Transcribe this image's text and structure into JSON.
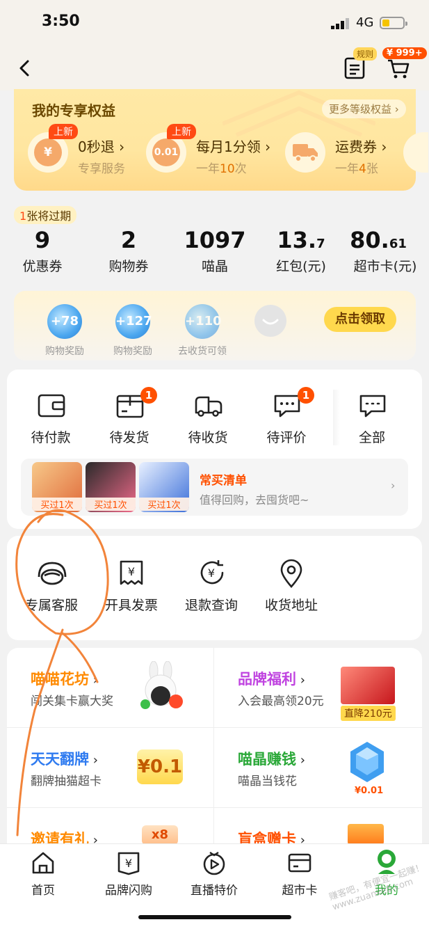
{
  "status_bar": {
    "time": "3:50",
    "network": "4G"
  },
  "header": {
    "rule_badge": "规则",
    "cart_badge": "¥ 999+"
  },
  "benefits": {
    "title": "我的专享权益",
    "more": "更多等级权益 ›",
    "items": [
      {
        "tag": "上新",
        "icon_text": "¥",
        "name": "0秒退 ›",
        "sub": "专享服务",
        "sub_hl": ""
      },
      {
        "tag": "上新",
        "icon_text": "0.01",
        "name": "每月1分领 ›",
        "sub_pre": "一年",
        "sub_hl": "10",
        "sub_post": "次"
      },
      {
        "tag": "",
        "icon_text": "",
        "name": "运费券 ›",
        "sub_pre": "一年",
        "sub_hl": "4",
        "sub_post": "张"
      }
    ]
  },
  "assets": {
    "expire_num": "1",
    "expire_text": "张将过期",
    "items": [
      {
        "value": "9",
        "small": "",
        "label": "优惠券"
      },
      {
        "value": "2",
        "small": "",
        "label": "购物券"
      },
      {
        "value": "1097",
        "small": "",
        "label": "喵晶"
      },
      {
        "value": "13.",
        "small": "7",
        "label": "红包(元)"
      },
      {
        "value": "80.",
        "small": "61",
        "label": "超市卡(元)"
      }
    ]
  },
  "rewards": {
    "items": [
      {
        "value": "+78",
        "label": "购物奖励"
      },
      {
        "value": "+127",
        "label": "购物奖励"
      },
      {
        "value": "+110",
        "label": "去收货可领"
      }
    ],
    "claim": "点击领取"
  },
  "orders": {
    "items": [
      {
        "label": "待付款",
        "badge": ""
      },
      {
        "label": "待发货",
        "badge": "1"
      },
      {
        "label": "待收货",
        "badge": ""
      },
      {
        "label": "待评价",
        "badge": "1"
      },
      {
        "label": "全部",
        "badge": ""
      }
    ],
    "buy_list": {
      "thumb_label": "买过1次",
      "title": "常买清单",
      "subtitle": "值得回购，去囤货吧~",
      "arrow": "›"
    }
  },
  "services": [
    {
      "label": "专属客服"
    },
    {
      "label": "开具发票"
    },
    {
      "label": "退款查询"
    },
    {
      "label": "收货地址"
    }
  ],
  "promos": [
    {
      "title": "喵喵花坊",
      "sub": "闯关集卡赢大奖",
      "color": "#ff8a00"
    },
    {
      "title": "品牌福利",
      "sub": "入会最高领20元",
      "color": "#c044e0",
      "badge": "直降210元"
    },
    {
      "title": "天天翻牌",
      "sub": "翻牌抽猫超卡",
      "color": "#2f7bf0",
      "tile": "¥0.1"
    },
    {
      "title": "喵晶赚钱",
      "sub": "喵晶当钱花",
      "color": "#2aa838",
      "tile": "¥0.01"
    },
    {
      "title": "邀请有礼",
      "sub": "",
      "color": "#ff8a00",
      "tile": "x8"
    },
    {
      "title": "盲盒赠卡",
      "sub": "",
      "color": "#ff5000"
    }
  ],
  "tabs": [
    {
      "label": "首页"
    },
    {
      "label": "品牌闪购"
    },
    {
      "label": "直播特价"
    },
    {
      "label": "超市卡"
    },
    {
      "label": "我的"
    }
  ],
  "watermark": "赚客吧，有便宜一起赚！ www.zuanke8.com",
  "colors": {
    "accent": "#ff5000",
    "gold": "#ffd84d",
    "active_tab": "#2aa838"
  }
}
